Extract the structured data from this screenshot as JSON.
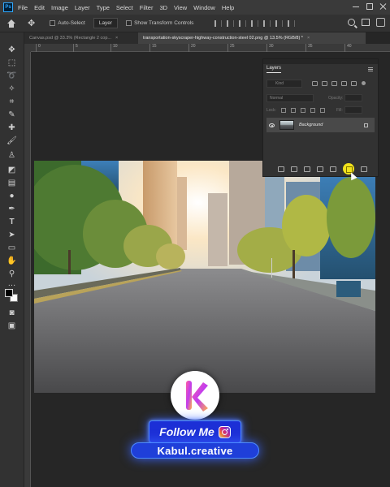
{
  "app": {
    "logo_text": "Ps"
  },
  "menu": [
    "File",
    "Edit",
    "Image",
    "Layer",
    "Type",
    "Select",
    "Filter",
    "3D",
    "View",
    "Window",
    "Help"
  ],
  "options_bar": {
    "auto_select_label": "Auto-Select",
    "auto_select_target": "Layer",
    "show_transform_controls_label": "Show Transform Controls"
  },
  "tabs": [
    {
      "label": "Canvas.psd @ 33.3% (Rectangle 2 cop...",
      "active": false
    },
    {
      "label": "transportation-skyscraper-highway-construction-steel 02.png @ 13.5% (RGB/8) *",
      "active": true
    }
  ],
  "ruler": {
    "top_ticks": [
      "0",
      "5",
      "10",
      "15",
      "20",
      "25",
      "30",
      "35",
      "40"
    ]
  },
  "layers_panel": {
    "title": "Layers",
    "kind_placeholder": "Kind",
    "blend_mode": "Normal",
    "opacity_label": "Opacity:",
    "lock_label": "Lock:",
    "fill_label": "Fill:",
    "layers": [
      {
        "name": "Background",
        "visible": true,
        "locked": true
      }
    ]
  },
  "branding": {
    "follow_text": "Follow Me",
    "handle": "Kabul.creative"
  },
  "colors": {
    "accent": "#31a8ff",
    "highlight": "#f1e21b",
    "brand_blue": "#1c2fd6"
  },
  "icons": [
    "home-icon",
    "move-tool-icon",
    "search-icon",
    "frame-icon",
    "share-icon",
    "instagram-icon",
    "eye-icon",
    "lock-icon"
  ]
}
